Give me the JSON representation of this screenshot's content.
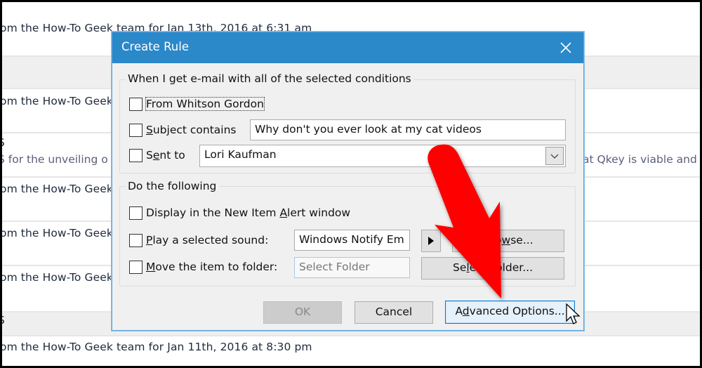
{
  "background_list": {
    "rows": [
      {
        "text": "om the How-To Geek team for Jan 13th, 2016 at 6:31 am"
      },
      {
        "text": "om the How-To Geek"
      },
      {
        "header": "S",
        "preview_left": "S for the unveiling o",
        "preview_right": "at Qkey is viable and"
      },
      {
        "text": "om the How-To Geek"
      },
      {
        "text": "om the How-To Geek"
      },
      {
        "text": "om the How-To Geek"
      },
      {
        "header": "S"
      },
      {
        "text": "om the How-To Geek team for Jan 11th, 2016 at 8:30 pm"
      }
    ]
  },
  "dialog": {
    "title": "Create Rule",
    "close_icon": "close-icon",
    "conditions": {
      "legend": "When I get e-mail with all of the selected conditions",
      "from": {
        "label": "From Whitson Gordon",
        "checked": false
      },
      "subject": {
        "label_pre": "",
        "label_u": "S",
        "label_post": "ubject contains",
        "checked": false,
        "value": "Why don't you ever look at my cat videos"
      },
      "sent_to": {
        "label_pre": "S",
        "label_u": "e",
        "label_post": "nt to",
        "checked": false,
        "value": "Lori Kaufman"
      }
    },
    "actions": {
      "legend": "Do the following",
      "display_alert": {
        "label_pre": "Display in the New Item ",
        "label_u": "A",
        "label_post": "lert window",
        "checked": false
      },
      "play_sound": {
        "label_pre": "",
        "label_u": "P",
        "label_post": "lay a selected sound:",
        "checked": false,
        "value": "Windows Notify Em",
        "play_icon": "play-icon",
        "browse_pre": "Bro",
        "browse_u": "w",
        "browse_post": "se..."
      },
      "move_folder": {
        "label_pre": "",
        "label_u": "M",
        "label_post": "ove the item to folder:",
        "checked": false,
        "placeholder": "Select Folder",
        "select_pre": "Se",
        "select_u": "l",
        "select_post": "ect Folder..."
      }
    },
    "buttons": {
      "ok": "OK",
      "cancel": "Cancel",
      "advanced_pre": "A",
      "advanced_u": "d",
      "advanced_post": "vanced Options..."
    }
  },
  "annotation": {
    "arrow_color": "#ff0000",
    "arrow_icon": "red-arrow-icon",
    "cursor_icon": "mouse-cursor-icon"
  }
}
